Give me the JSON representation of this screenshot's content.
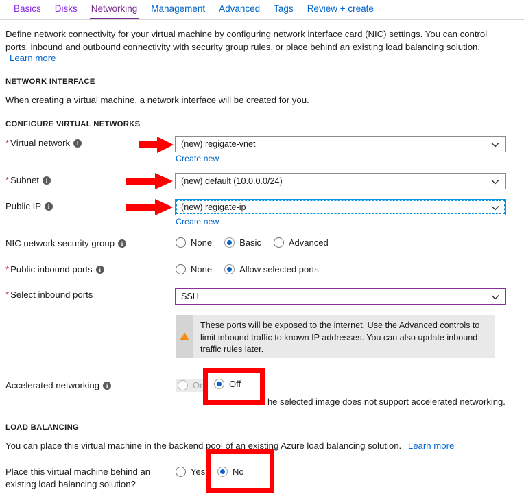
{
  "tabs": [
    {
      "label": "Basics",
      "state": "visited"
    },
    {
      "label": "Disks",
      "state": "visited"
    },
    {
      "label": "Networking",
      "state": "active"
    },
    {
      "label": "Management",
      "state": "normal"
    },
    {
      "label": "Advanced",
      "state": "normal"
    },
    {
      "label": "Tags",
      "state": "normal"
    },
    {
      "label": "Review + create",
      "state": "normal"
    }
  ],
  "intro": {
    "paragraph": "Define network connectivity for your virtual machine by configuring network interface card (NIC) settings. You can control ports, inbound and outbound connectivity with security group rules, or place behind an existing load balancing solution.",
    "learn_more": "Learn more"
  },
  "network_interface": {
    "heading": "NETWORK INTERFACE",
    "description": "When creating a virtual machine, a network interface will be created for you."
  },
  "configure_virtual_networks": {
    "heading": "CONFIGURE VIRTUAL NETWORKS",
    "virtual_network": {
      "label": "Virtual network",
      "required": true,
      "value": "(new) regigate-vnet",
      "create_new": "Create new"
    },
    "subnet": {
      "label": "Subnet",
      "required": true,
      "value": "(new) default (10.0.0.0/24)"
    },
    "public_ip": {
      "label": "Public IP",
      "required": false,
      "value": "(new) regigate-ip",
      "create_new": "Create new"
    },
    "nic_network_security_group": {
      "label": "NIC network security group",
      "options": [
        "None",
        "Basic",
        "Advanced"
      ],
      "selected": "Basic"
    },
    "public_inbound_ports": {
      "label": "Public inbound ports",
      "required": true,
      "options": [
        "None",
        "Allow selected ports"
      ],
      "selected": "Allow selected ports"
    },
    "select_inbound_ports": {
      "label": "Select inbound ports",
      "required": true,
      "value": "SSH"
    },
    "warning": {
      "icon": "warning-triangle-icon",
      "text": "These ports will be exposed to the internet. Use the Advanced controls to limit inbound traffic to known IP addresses. You can also update inbound traffic rules later."
    },
    "accelerated_networking": {
      "label": "Accelerated networking",
      "options": [
        "On",
        "Off"
      ],
      "selected": "Off",
      "disabled_option": "On",
      "note": "The selected image does not support accelerated networking."
    }
  },
  "load_balancing": {
    "heading": "LOAD BALANCING",
    "description": "You can place this virtual machine in the backend pool of an existing Azure load balancing solution.",
    "learn_more": "Learn more",
    "place_behind": {
      "label": "Place this virtual machine behind an existing load balancing solution?",
      "options": [
        "Yes",
        "No"
      ],
      "selected": "No"
    }
  },
  "colors": {
    "link": "#0066cc",
    "active_tab": "#7a2d8f",
    "visited_tab": "#8a2be2",
    "required_asterisk": "#d1343f",
    "radio_selected": "#0a64c8",
    "annotation_red": "#fe0000",
    "focus_blue": "#0a93e0",
    "purple_border": "#8a2f9e",
    "warning_orange": "#f08a18"
  },
  "annotations": {
    "arrow_virtual_network": "red-arrow-right",
    "arrow_subnet": "red-arrow-right",
    "arrow_public_ip": "red-arrow-right",
    "box_accelerated_off": "red-highlight-box",
    "box_load_balancing_no": "red-highlight-box"
  }
}
